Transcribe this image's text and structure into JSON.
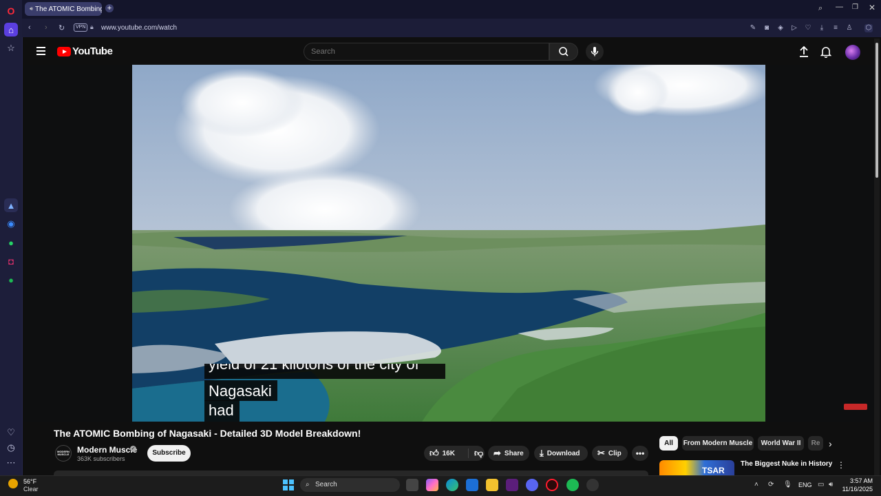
{
  "browser": {
    "tab_title": "The ATOMIC Bombing",
    "url": "www.youtube.com/watch",
    "vpn_label": "VPN"
  },
  "youtube": {
    "logo_text": "YouTube",
    "search_placeholder": "Search"
  },
  "video": {
    "caption_line1": "Nagasaki",
    "caption_line2": "had",
    "caption_partial": "yield of 21 kilotons of the city of"
  },
  "info": {
    "title": "The ATOMIC Bombing of Nagasaki - Detailed 3D Model Breakdown!",
    "channel_name": "Modern Muscle",
    "channel_avatar_text": "MODERN MUSCLE",
    "subscribers": "363K subscribers",
    "subscribe_label": "Subscribe",
    "likes": "16K",
    "share_label": "Share",
    "download_label": "Download",
    "clip_label": "Clip",
    "more_label": "•••"
  },
  "chips": {
    "all": "All",
    "from_channel": "From Modern Muscle",
    "ww2": "World War II",
    "partial": "Re"
  },
  "recommendation": {
    "title": "The Biggest Nuke in History",
    "thumb_text": "TSAR"
  },
  "taskbar": {
    "temp": "56°F",
    "condition": "Clear",
    "search_label": "Search",
    "lang": "ENG",
    "time": "3:57 AM",
    "date": "11/16/2025"
  }
}
